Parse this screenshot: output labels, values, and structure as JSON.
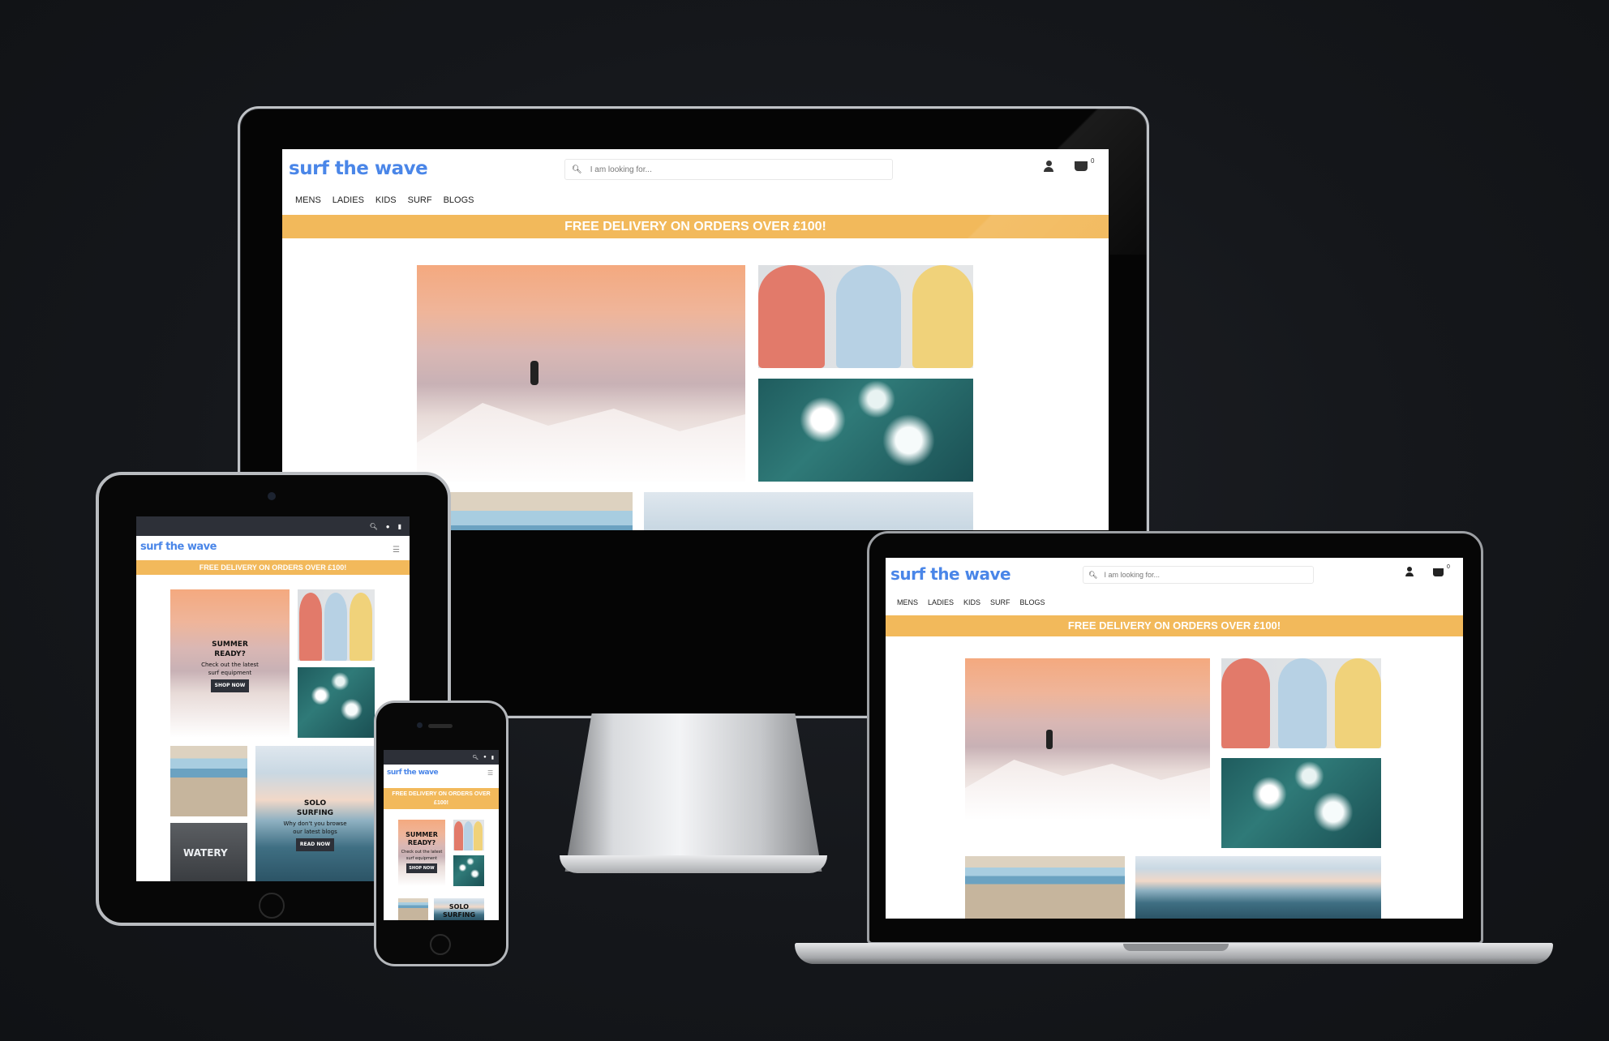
{
  "brand": {
    "name": "surf the wave",
    "color": "#4a86e8"
  },
  "banner": {
    "text": "FREE DELIVERY ON ORDERS OVER £100!",
    "color": "#f2b95b"
  },
  "search": {
    "placeholder": "I am looking for..."
  },
  "nav": [
    "MENS",
    "LADIES",
    "KIDS",
    "SURF",
    "BLOGS"
  ],
  "basket": {
    "count": "0"
  },
  "tiles": {
    "watery_text": "WATERY"
  },
  "promo_summer": {
    "title_1": "SUMMER",
    "title_2": "READY?",
    "body_1": "Check out the latest",
    "body_2": "surf equipment",
    "button": "SHOP NOW"
  },
  "promo_solo": {
    "title_1": "SOLO",
    "title_2": "SURFING",
    "body_1": "Why don't you browse",
    "body_2": "our latest blogs",
    "button": "READ NOW"
  },
  "phone_promo": {
    "title_1": "SUMMER",
    "title_2": "READY?",
    "body_1": "Check out the latest",
    "body_2": "surf equipment",
    "button": "SHOP NOW",
    "solo": "SOLO",
    "solo_2": "SURFING"
  },
  "icons": [
    "search-icon",
    "user-icon",
    "basket-icon",
    "hamburger-icon"
  ]
}
